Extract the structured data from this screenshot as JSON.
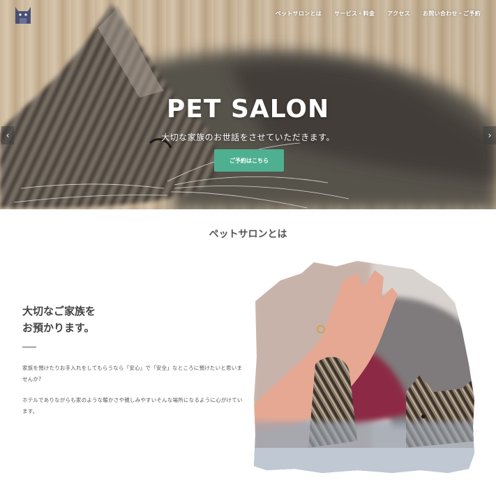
{
  "nav": {
    "items": [
      {
        "label": "ペットサロンとは"
      },
      {
        "label": "サービス・料金"
      },
      {
        "label": "アクセス"
      },
      {
        "label": "お問い合わせ・ご予約"
      }
    ]
  },
  "hero": {
    "title": "PET SALON",
    "subtitle": "大切な家族のお世話をさせていただきます。",
    "cta_label": "ご予約はこちら"
  },
  "about": {
    "section_title": "ペットサロンとは",
    "headline_line1": "大切なご家族を",
    "headline_line2": "お預かります。",
    "paragraph1": "家族を預けたりお手入れをしてもらうなら「安心」で「安全」なところに預けたいと思いませんか?",
    "paragraph2": "ホテルでありながらも家のような暖かさや親しみやすいそんな場所になるように心がけています。"
  },
  "colors": {
    "accent": "#4fb091",
    "text": "#444444"
  },
  "icons": {
    "logo": "cat-logo-icon",
    "prev": "chevron-left-icon",
    "next": "chevron-right-icon"
  }
}
